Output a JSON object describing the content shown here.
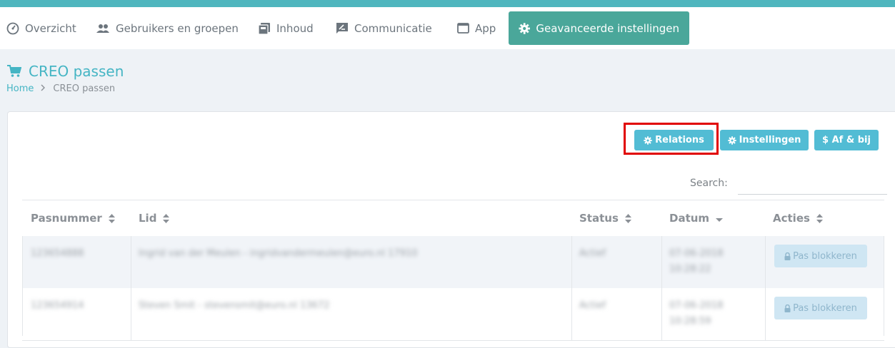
{
  "nav": {
    "items": [
      {
        "label": "Overzicht",
        "icon": "dashboard-icon"
      },
      {
        "label": "Gebruikers en groepen",
        "icon": "users-icon"
      },
      {
        "label": "Inhoud",
        "icon": "content-icon"
      },
      {
        "label": "Communicatie",
        "icon": "message-icon"
      },
      {
        "label": "App",
        "icon": "window-icon"
      },
      {
        "label": "Geavanceerde instellingen",
        "icon": "gear-icon",
        "active": true
      }
    ]
  },
  "page": {
    "title": "CREO passen",
    "title_icon": "cart-icon",
    "breadcrumb": {
      "home": "Home",
      "current": "CREO passen"
    }
  },
  "toolbar": {
    "relations": "Relations",
    "instellingen": "Instellingen",
    "afbij": "$ Af & bij"
  },
  "search": {
    "label": "Search:",
    "value": ""
  },
  "table": {
    "columns": [
      "Pasnummer",
      "Lid",
      "Status",
      "Datum",
      "Acties"
    ],
    "rows": [
      {
        "pasnummer": "123654888",
        "lid": "Ingrid van der Meulen - ingridvandermeulen@euro.nl 17910",
        "status": "Actief",
        "datum_line1": "07-06-2018",
        "datum_line2": "10:28:22",
        "action": "Pas blokkeren"
      },
      {
        "pasnummer": "123654914",
        "lid": "Steven Smit - stevensmit@euro.nl 13672",
        "status": "Actief",
        "datum_line1": "07-06-2018",
        "datum_line2": "10:28:59",
        "action": "Pas blokkeren"
      }
    ]
  },
  "colors": {
    "accent": "#45b5c4",
    "nav_active": "#4aa79a",
    "button": "#52bcd4",
    "highlight": "#e10000"
  }
}
